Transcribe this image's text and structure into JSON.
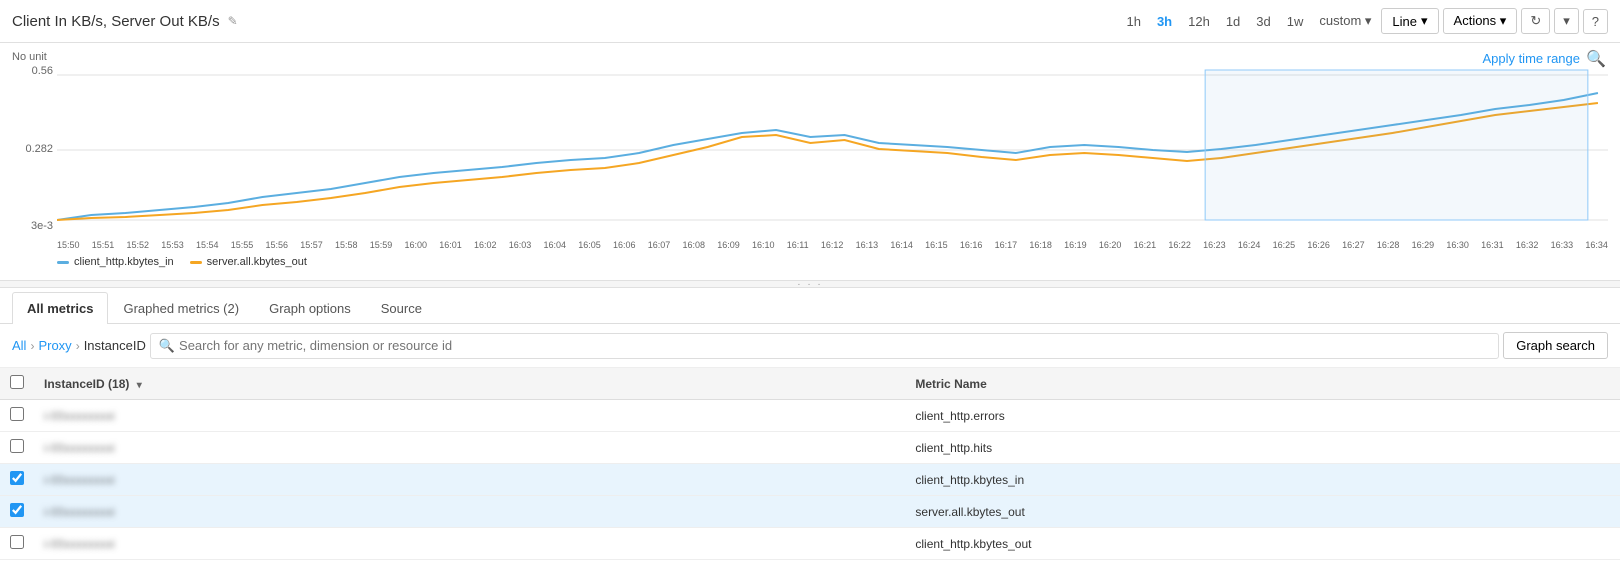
{
  "header": {
    "title": "Client In KB/s, Server Out KB/s",
    "edit_icon": "✎",
    "time_options": [
      "1h",
      "3h",
      "12h",
      "1d",
      "3d",
      "1w",
      "custom"
    ],
    "active_time": "3h",
    "chart_type": "Line",
    "actions_label": "Actions",
    "apply_time_range": "Apply time range"
  },
  "chart": {
    "no_unit": "No unit",
    "y_ticks": [
      "0.56",
      "0.282",
      "3e-3"
    ],
    "x_ticks": [
      "15:50",
      "15:51",
      "15:52",
      "15:53",
      "15:54",
      "15:55",
      "15:56",
      "15:57",
      "15:58",
      "15:59",
      "16:00",
      "16:01",
      "16:02",
      "16:03",
      "16:04",
      "16:05",
      "16:06",
      "16:07",
      "16:08",
      "16:09",
      "16:10",
      "16:11",
      "16:12",
      "16:13",
      "16:14",
      "16:15",
      "16:16",
      "16:17",
      "16:18",
      "16:19",
      "16:20",
      "16:21",
      "16:22",
      "16:23",
      "16:24",
      "16:25",
      "16:26",
      "16:27",
      "16:28",
      "16:29",
      "16:30",
      "16:31",
      "16:32",
      "16:33",
      "16:34"
    ],
    "legend": [
      {
        "label": "client_http.kbytes_in",
        "color": "#5BAEE0"
      },
      {
        "label": "server.all.kbytes_out",
        "color": "#F5A623"
      }
    ]
  },
  "tabs": [
    {
      "label": "All metrics",
      "active": true
    },
    {
      "label": "Graphed metrics (2)",
      "active": false
    },
    {
      "label": "Graph options",
      "active": false
    },
    {
      "label": "Source",
      "active": false
    }
  ],
  "filter": {
    "all": "All",
    "proxy": "Proxy",
    "instance_id": "InstanceID",
    "search_placeholder": "Search for any metric, dimension or resource id",
    "graph_search": "Graph search"
  },
  "table": {
    "col_instance": "InstanceID (18)",
    "col_metric": "Metric Name",
    "rows": [
      {
        "instance": "i-0",
        "suffix": "i",
        "metric": "client_http.errors",
        "checked": false,
        "blurred": true
      },
      {
        "instance": "i-0",
        "suffix": "i",
        "metric": "client_http.hits",
        "checked": false,
        "blurred": true
      },
      {
        "instance": "i-0",
        "suffix": "i",
        "metric": "client_http.kbytes_in",
        "checked": true,
        "blurred": true
      },
      {
        "instance": "i-0",
        "suffix": "i",
        "metric": "server.all.kbytes_out",
        "checked": true,
        "blurred": true
      },
      {
        "instance": "i-0",
        "suffix": "i",
        "metric": "client_http.kbytes_out",
        "checked": false,
        "blurred": true
      }
    ]
  }
}
